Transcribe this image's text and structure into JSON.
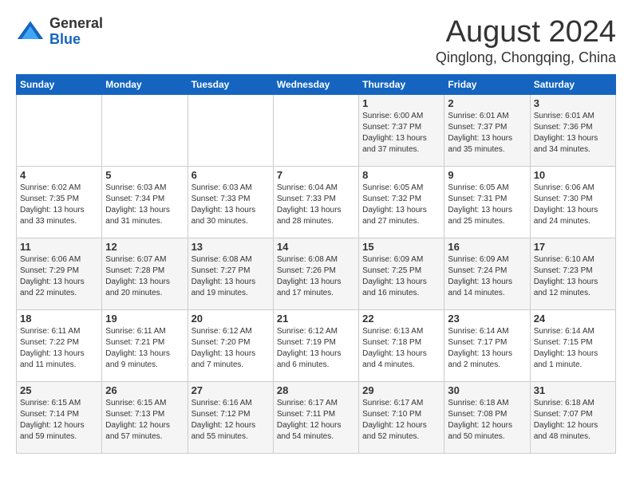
{
  "logo": {
    "general": "General",
    "blue": "Blue"
  },
  "title": {
    "month_year": "August 2024",
    "location": "Qinglong, Chongqing, China"
  },
  "days_header": [
    "Sunday",
    "Monday",
    "Tuesday",
    "Wednesday",
    "Thursday",
    "Friday",
    "Saturday"
  ],
  "weeks": [
    [
      {
        "day": "",
        "content": ""
      },
      {
        "day": "",
        "content": ""
      },
      {
        "day": "",
        "content": ""
      },
      {
        "day": "",
        "content": ""
      },
      {
        "day": "1",
        "content": "Sunrise: 6:00 AM\nSunset: 7:37 PM\nDaylight: 13 hours\nand 37 minutes."
      },
      {
        "day": "2",
        "content": "Sunrise: 6:01 AM\nSunset: 7:37 PM\nDaylight: 13 hours\nand 35 minutes."
      },
      {
        "day": "3",
        "content": "Sunrise: 6:01 AM\nSunset: 7:36 PM\nDaylight: 13 hours\nand 34 minutes."
      }
    ],
    [
      {
        "day": "4",
        "content": "Sunrise: 6:02 AM\nSunset: 7:35 PM\nDaylight: 13 hours\nand 33 minutes."
      },
      {
        "day": "5",
        "content": "Sunrise: 6:03 AM\nSunset: 7:34 PM\nDaylight: 13 hours\nand 31 minutes."
      },
      {
        "day": "6",
        "content": "Sunrise: 6:03 AM\nSunset: 7:33 PM\nDaylight: 13 hours\nand 30 minutes."
      },
      {
        "day": "7",
        "content": "Sunrise: 6:04 AM\nSunset: 7:33 PM\nDaylight: 13 hours\nand 28 minutes."
      },
      {
        "day": "8",
        "content": "Sunrise: 6:05 AM\nSunset: 7:32 PM\nDaylight: 13 hours\nand 27 minutes."
      },
      {
        "day": "9",
        "content": "Sunrise: 6:05 AM\nSunset: 7:31 PM\nDaylight: 13 hours\nand 25 minutes."
      },
      {
        "day": "10",
        "content": "Sunrise: 6:06 AM\nSunset: 7:30 PM\nDaylight: 13 hours\nand 24 minutes."
      }
    ],
    [
      {
        "day": "11",
        "content": "Sunrise: 6:06 AM\nSunset: 7:29 PM\nDaylight: 13 hours\nand 22 minutes."
      },
      {
        "day": "12",
        "content": "Sunrise: 6:07 AM\nSunset: 7:28 PM\nDaylight: 13 hours\nand 20 minutes."
      },
      {
        "day": "13",
        "content": "Sunrise: 6:08 AM\nSunset: 7:27 PM\nDaylight: 13 hours\nand 19 minutes."
      },
      {
        "day": "14",
        "content": "Sunrise: 6:08 AM\nSunset: 7:26 PM\nDaylight: 13 hours\nand 17 minutes."
      },
      {
        "day": "15",
        "content": "Sunrise: 6:09 AM\nSunset: 7:25 PM\nDaylight: 13 hours\nand 16 minutes."
      },
      {
        "day": "16",
        "content": "Sunrise: 6:09 AM\nSunset: 7:24 PM\nDaylight: 13 hours\nand 14 minutes."
      },
      {
        "day": "17",
        "content": "Sunrise: 6:10 AM\nSunset: 7:23 PM\nDaylight: 13 hours\nand 12 minutes."
      }
    ],
    [
      {
        "day": "18",
        "content": "Sunrise: 6:11 AM\nSunset: 7:22 PM\nDaylight: 13 hours\nand 11 minutes."
      },
      {
        "day": "19",
        "content": "Sunrise: 6:11 AM\nSunset: 7:21 PM\nDaylight: 13 hours\nand 9 minutes."
      },
      {
        "day": "20",
        "content": "Sunrise: 6:12 AM\nSunset: 7:20 PM\nDaylight: 13 hours\nand 7 minutes."
      },
      {
        "day": "21",
        "content": "Sunrise: 6:12 AM\nSunset: 7:19 PM\nDaylight: 13 hours\nand 6 minutes."
      },
      {
        "day": "22",
        "content": "Sunrise: 6:13 AM\nSunset: 7:18 PM\nDaylight: 13 hours\nand 4 minutes."
      },
      {
        "day": "23",
        "content": "Sunrise: 6:14 AM\nSunset: 7:17 PM\nDaylight: 13 hours\nand 2 minutes."
      },
      {
        "day": "24",
        "content": "Sunrise: 6:14 AM\nSunset: 7:15 PM\nDaylight: 13 hours\nand 1 minute."
      }
    ],
    [
      {
        "day": "25",
        "content": "Sunrise: 6:15 AM\nSunset: 7:14 PM\nDaylight: 12 hours\nand 59 minutes."
      },
      {
        "day": "26",
        "content": "Sunrise: 6:15 AM\nSunset: 7:13 PM\nDaylight: 12 hours\nand 57 minutes."
      },
      {
        "day": "27",
        "content": "Sunrise: 6:16 AM\nSunset: 7:12 PM\nDaylight: 12 hours\nand 55 minutes."
      },
      {
        "day": "28",
        "content": "Sunrise: 6:17 AM\nSunset: 7:11 PM\nDaylight: 12 hours\nand 54 minutes."
      },
      {
        "day": "29",
        "content": "Sunrise: 6:17 AM\nSunset: 7:10 PM\nDaylight: 12 hours\nand 52 minutes."
      },
      {
        "day": "30",
        "content": "Sunrise: 6:18 AM\nSunset: 7:08 PM\nDaylight: 12 hours\nand 50 minutes."
      },
      {
        "day": "31",
        "content": "Sunrise: 6:18 AM\nSunset: 7:07 PM\nDaylight: 12 hours\nand 48 minutes."
      }
    ]
  ]
}
